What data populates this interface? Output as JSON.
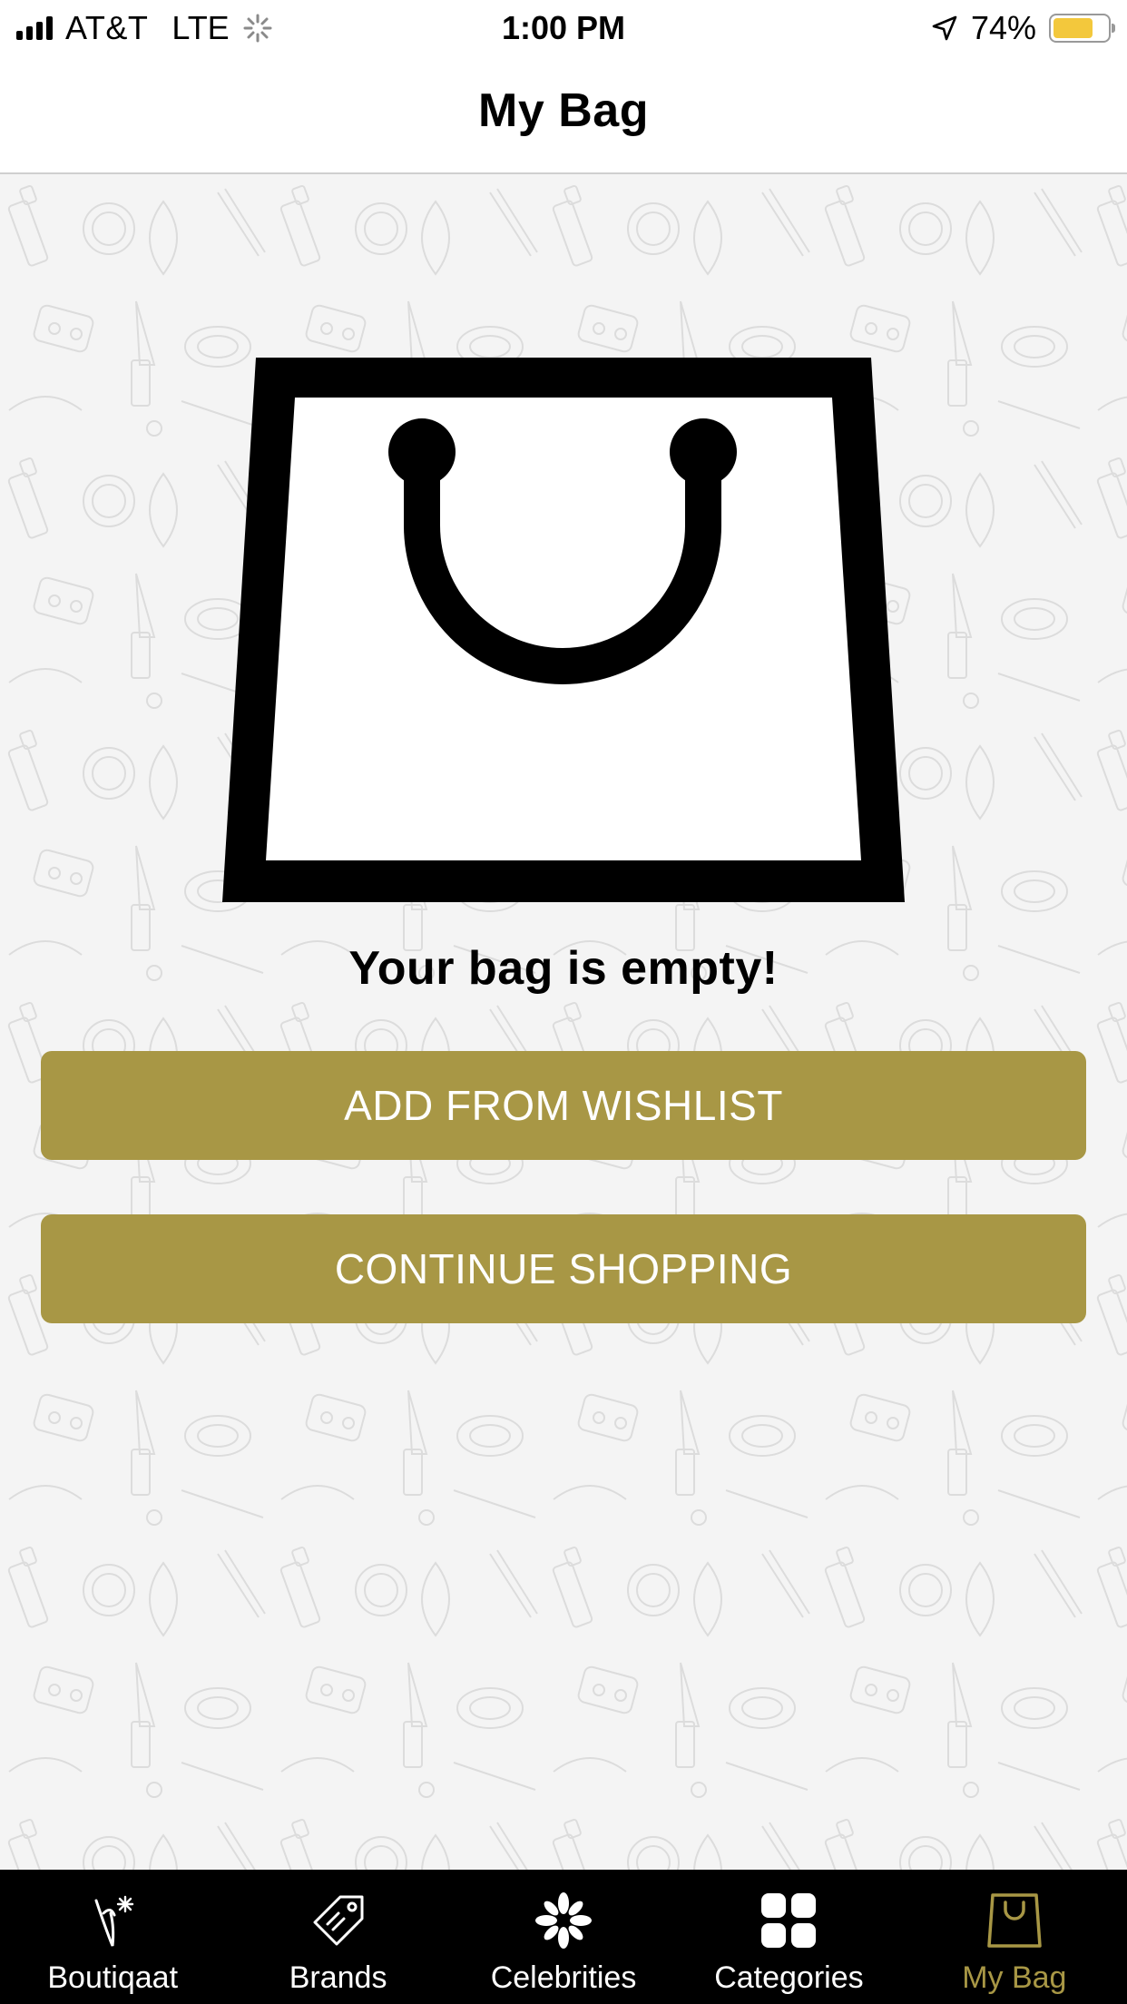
{
  "status_bar": {
    "carrier": "AT&T",
    "network": "LTE",
    "time": "1:00 PM",
    "battery": "74%",
    "battery_level": 0.74,
    "battery_color": "#f3c83c"
  },
  "header": {
    "title": "My Bag"
  },
  "empty_state": {
    "message": "Your bag is empty!",
    "icon": "shopping-bag-icon"
  },
  "actions": {
    "add_from_wishlist": "ADD FROM WISHLIST",
    "continue_shopping": "CONTINUE SHOPPING"
  },
  "tab_bar": {
    "active_tab": "my-bag",
    "tabs": [
      {
        "label": "Boutiqaat",
        "icon": "boutiqaat-logo-icon"
      },
      {
        "label": "Brands",
        "icon": "tag-icon"
      },
      {
        "label": "Celebrities",
        "icon": "flower-icon"
      },
      {
        "label": "Categories",
        "icon": "grid-icon"
      },
      {
        "label": "My Bag",
        "icon": "bag-icon"
      }
    ]
  },
  "colors": {
    "accent": "#a89745",
    "tab_bar_background": "#000000",
    "button_text": "#ffffff",
    "page_background": "#f4f4f4"
  }
}
